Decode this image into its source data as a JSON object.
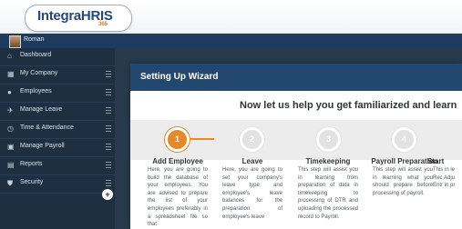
{
  "app": {
    "logo_text": "IntegraHRIS",
    "logo_sub": "365",
    "user_name": "Roman"
  },
  "sidebar": {
    "items": [
      {
        "label": "Dashboard",
        "icon": "home-icon",
        "has_menu": false
      },
      {
        "label": "My Company",
        "icon": "building-icon",
        "has_menu": true
      },
      {
        "label": "Employees",
        "icon": "users-icon",
        "has_menu": true
      },
      {
        "label": "Manage Leave",
        "icon": "plane-icon",
        "has_menu": true
      },
      {
        "label": "Time & Attendance",
        "icon": "clock-icon",
        "has_menu": true
      },
      {
        "label": "Manage Payroll",
        "icon": "payroll-icon",
        "has_menu": true
      },
      {
        "label": "Reports",
        "icon": "reports-icon",
        "has_menu": true
      },
      {
        "label": "Security",
        "icon": "shield-icon",
        "has_menu": true
      }
    ],
    "collapse_glyph": "+"
  },
  "wizard": {
    "title": "Setting Up Wizard",
    "subtitle": "Now let us help you get familiarized and learn",
    "accent_color": "#e58a2c",
    "steps": [
      {
        "number": "1",
        "title": "Add Employee",
        "desc": "Here, you are going to build the database of your employees. You are advised to prepare the list of your employees preferably in a spreadsheet file so that"
      },
      {
        "number": "2",
        "title": "Leave",
        "desc": "Here, you are going to set your company's leave type and employee's leave balances for the preparation of employee's leave"
      },
      {
        "number": "3",
        "title": "Timekeeping",
        "desc": "This step will assist you in learning from preparation of data in timekeeping to processing of DTR and uploading the processed record to Payroll."
      },
      {
        "number": "4",
        "title": "Payroll Preparation",
        "desc": "This step will assist you in learning what you should prepare before processing of payroll."
      },
      {
        "number": "",
        "title": "Start",
        "desc": "This in le Rec Adju Entr in pr"
      }
    ]
  }
}
